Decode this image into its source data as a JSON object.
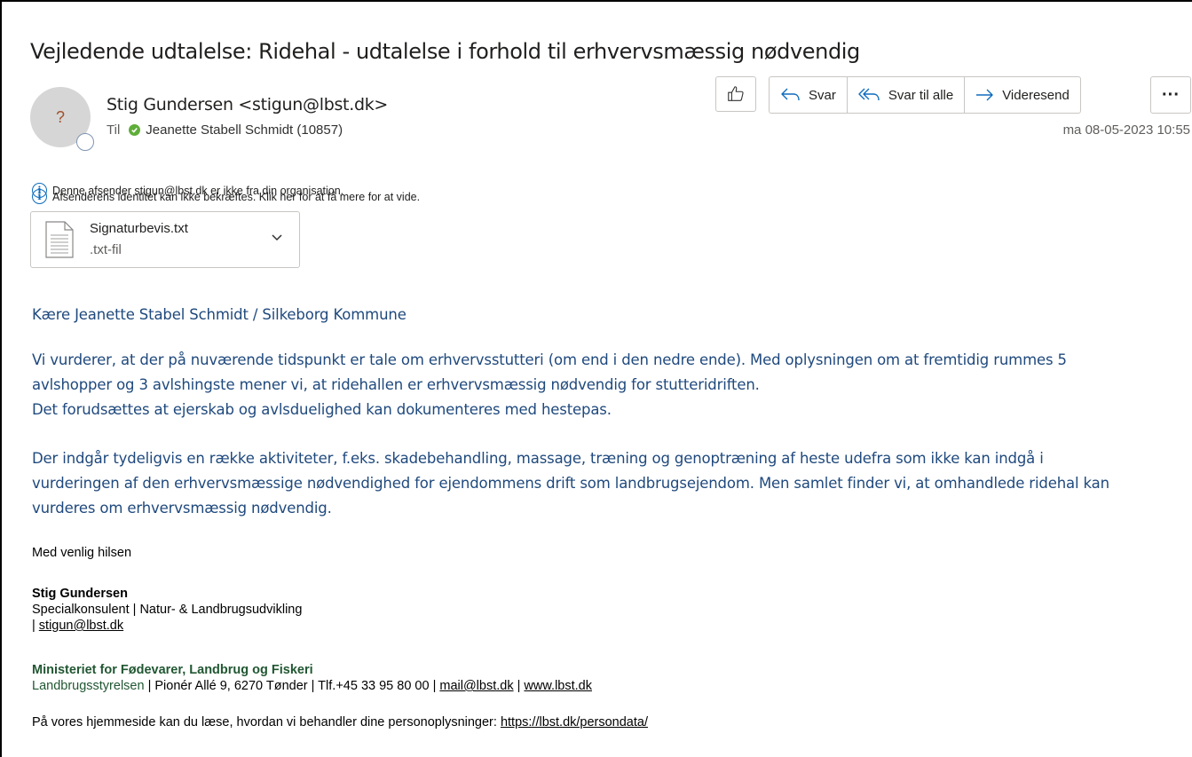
{
  "email": {
    "subject": "Vejledende udtalelse: Ridehal - udtalelse i forhold til erhvervsmæssig nødvendig",
    "avatar_initial": "?",
    "sender": "Stig Gundersen <stigun@lbst.dk>",
    "to_label": "Til",
    "recipient": "Jeanette Stabell Schmidt (10857)",
    "date": "ma 08-05-2023 10:55",
    "toolbar": {
      "like_icon": "thumbs-up-icon",
      "reply": "Svar",
      "reply_all": "Svar til alle",
      "forward": "Videresend",
      "more": "···"
    },
    "info_external": "Denne afsender stigun@lbst.dk er ikke fra din organisation.",
    "info_identity": "Afsenderens identitet kan ikke bekræftes. Klik her for at få mere for at vide.",
    "attachment": {
      "name": "Signaturbevis.txt",
      "type": ".txt-fil"
    }
  },
  "body": {
    "greeting": "Kære Jeanette Stabel Schmidt / Silkeborg Kommune",
    "para1_line1": "Vi vurderer, at der på nuværende tidspunkt er tale om erhvervsstutteri (om end i den nedre ende). Med oplysningen om at fremtidig rummes 5",
    "para1_line2": "avlshopper og 3 avlshingste mener vi, at ridehallen er erhvervsmæssig nødvendig for stutteridriften.",
    "para1_line3": "Det forudsættes at ejerskab og avlsduelighed kan dokumenteres med hestepas.",
    "para2_line1": "Der indgår tydeligvis en række aktiviteter, f.eks. skadebehandling, massage, træning og genoptræning af heste udefra som ikke kan indgå i",
    "para2_line2": "vurderingen af den erhvervsmæssige nødvendighed for ejendommens drift som landbrugsejendom. Men samlet finder vi, at omhandlede ridehal kan",
    "para2_line3": "vurderes om erhvervsmæssig nødvendig.",
    "closing": "Med venlig hilsen"
  },
  "signature": {
    "name": "Stig Gundersen",
    "title": "Specialkonsulent | Natur- & Landbrugsudvikling",
    "email_prefix": "| ",
    "email": "stigun@lbst.dk",
    "ministry": "Ministeriet for Fødevarer, Landbrug og Fiskeri",
    "agency": "Landbrugsstyrelsen",
    "address": " | Pionér Allé 9, 6270 Tønder | Tlf.+45 33 95 80 00 | ",
    "agency_email": "mail@lbst.dk",
    "sep": " | ",
    "website": "www.lbst.dk",
    "privacy_text": "På vores hjemmeside kan du læse, hvordan vi behandler dine personoplysninger: ",
    "privacy_link": "https://lbst.dk/persondata/"
  },
  "colors": {
    "body_text": "#1f497d",
    "ministry_green": "#215732",
    "info_blue": "#0f6cbd",
    "presence_green": "#5fad39"
  }
}
